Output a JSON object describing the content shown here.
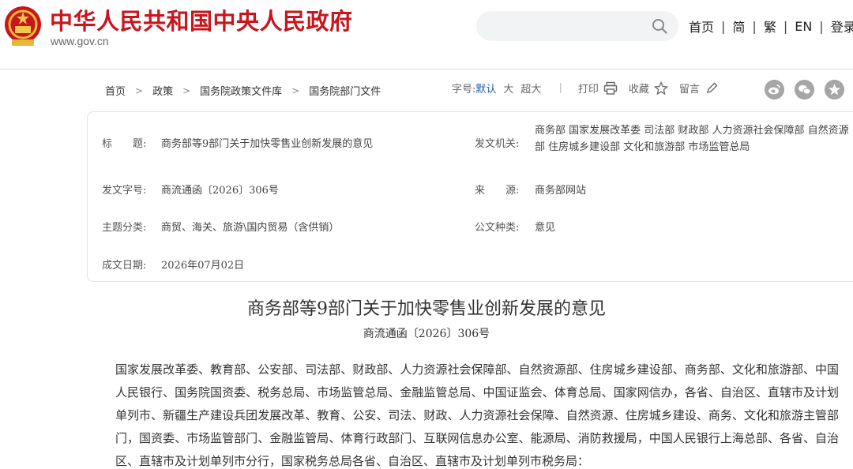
{
  "header": {
    "site_title": "中华人民共和国中央人民政府",
    "site_domain": "www.gov.cn",
    "search": {
      "placeholder": ""
    },
    "nav": [
      "首页",
      "简",
      "繁",
      "EN",
      "登录"
    ]
  },
  "breadcrumb": [
    "首页",
    "政策",
    "国务院政策文件库",
    "国务院部门文件"
  ],
  "toolbar": {
    "font_size_label": "字号:",
    "font_sizes": [
      "默认",
      "大",
      "超大"
    ],
    "print": "打印",
    "favorite": "收藏",
    "comment": "留言"
  },
  "info": {
    "title_label": "标　　题:",
    "title_value": "商务部等9部门关于加快零售业创新发展的意见",
    "issuer_label": "发文机关:",
    "issuer_value": "商务部 国家发展改革委 司法部 财政部 人力资源社会保障部 自然资源部 住房城乡建设部 文化和旅游部 市场监管总局",
    "docno_label": "发文字号:",
    "docno_value": "商流通函〔2026〕306号",
    "source_label": "来　　源:",
    "source_value": "商务部网站",
    "topic_label": "主题分类:",
    "topic_value": "商贸、海关、旅游\\国内贸易（含供销）",
    "type_label": "公文种类:",
    "type_value": "意见",
    "date_label": "成文日期:",
    "date_value": "2026年07月02日"
  },
  "article": {
    "title": "商务部等9部门关于加快零售业创新发展的意见",
    "doc_number": "商流通函〔2026〕306号",
    "body": "国家发展改革委、教育部、公安部、司法部、财政部、人力资源社会保障部、自然资源部、住房城乡建设部、商务部、文化和旅游部、中国人民银行、国务院国资委、税务总局、市场监管总局、金融监管总局、中国证监会、体育总局、国家网信办，各省、自治区、直辖市及计划单列市、新疆生产建设兵团发展改革、教育、公安、司法、财政、人力资源社会保障、自然资源、住房城乡建设、商务、文化和旅游主管部门，国资委、市场监管部门、金融监管局、体育行政部门、互联网信息办公室、能源局、消防救援局，中国人民银行上海总部、各省、自治区、直辖市及计划单列市分行，国家税务总局各省、自治区、直辖市及计划单列市税务局："
  },
  "colors": {
    "brand_red": "#c8161e",
    "link_blue": "#1f5fa8",
    "social_gray": "#a6a6a6"
  },
  "icons": [
    "national-emblem",
    "search-icon",
    "print-icon",
    "star-icon",
    "pencil-icon",
    "weibo-icon",
    "wechat-icon",
    "share-icon"
  ]
}
